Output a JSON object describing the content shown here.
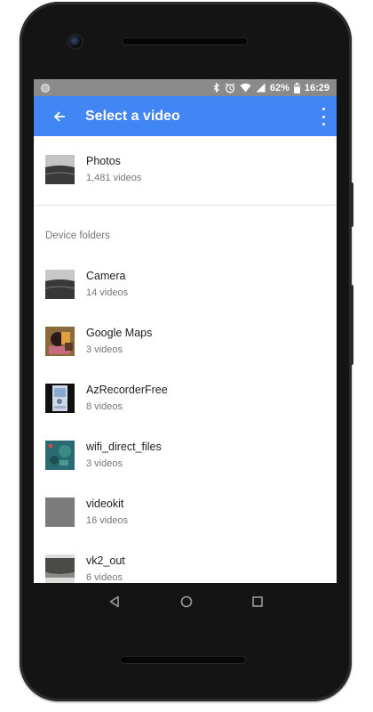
{
  "statusbar": {
    "battery": "62%",
    "time": "16:29",
    "icons": [
      "bluetooth-icon",
      "alarm-icon",
      "wifi-icon",
      "signal-icon",
      "battery-icon"
    ]
  },
  "appbar": {
    "title": "Select a video",
    "color": "#4285f4"
  },
  "photos": {
    "name": "Photos",
    "count": "1,481 videos"
  },
  "section_title": "Device folders",
  "folders": [
    {
      "name": "Camera",
      "count": "14 videos"
    },
    {
      "name": "Google Maps",
      "count": "3 videos"
    },
    {
      "name": "AzRecorderFree",
      "count": "8 videos"
    },
    {
      "name": "wifi_direct_files",
      "count": "3 videos"
    },
    {
      "name": "videokit",
      "count": "16 videos"
    },
    {
      "name": "vk2_out",
      "count": "6 videos"
    }
  ]
}
